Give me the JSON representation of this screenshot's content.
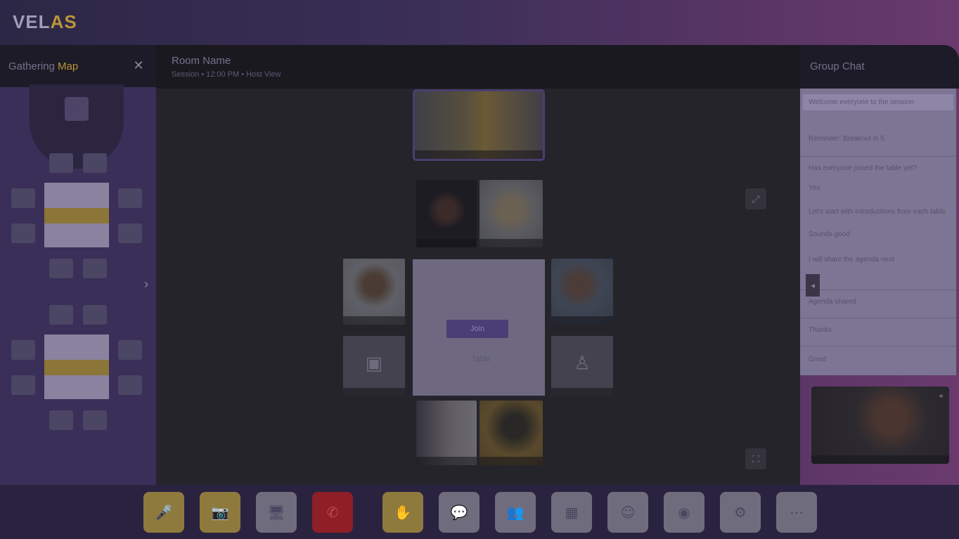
{
  "app": {
    "logo_main": "VEL",
    "logo_accent": "AS"
  },
  "left_panel": {
    "title_start": "Gathering ",
    "title_highlight": "Map",
    "close_icon": "close-icon"
  },
  "main": {
    "room_name": "Room Name",
    "room_meta": "Session • 12:00 PM • Host View"
  },
  "center_card": {
    "button_label": "Join",
    "caption": "Table"
  },
  "right_panel": {
    "title": "Group Chat",
    "messages": [
      "Welcome everyone to the session",
      "Reminder: Breakout in 5",
      "Has everyone joined the table yet?",
      "Yes",
      "Let's start with introductions from each table",
      "Sounds good",
      "I will share the agenda next",
      "Agenda shared",
      "Thanks",
      "Great"
    ]
  },
  "bottom_bar": {
    "controls": [
      {
        "name": "mic-button",
        "icon": "🎤",
        "style": "gold"
      },
      {
        "name": "camera-button",
        "icon": "📷",
        "style": "gold"
      },
      {
        "name": "screen-share-button",
        "icon": "🖥",
        "style": "grey"
      },
      {
        "name": "leave-button",
        "icon": "✆",
        "style": "red"
      },
      {
        "name": "hand-raise-button",
        "icon": "✋",
        "style": "gold"
      },
      {
        "name": "chat-button",
        "icon": "💬",
        "style": "grey"
      },
      {
        "name": "people-button",
        "icon": "👥",
        "style": "grey"
      },
      {
        "name": "grid-button",
        "icon": "▦",
        "style": "grey"
      },
      {
        "name": "reactions-button",
        "icon": "☺",
        "style": "grey"
      },
      {
        "name": "record-button",
        "icon": "◉",
        "style": "grey"
      },
      {
        "name": "settings-button",
        "icon": "⚙",
        "style": "grey"
      },
      {
        "name": "more-button",
        "icon": "⋯",
        "style": "grey"
      }
    ]
  },
  "colors": {
    "accent_gold": "#b8953a",
    "brand_purple": "#4b3e76",
    "danger_red": "#8e1f26"
  }
}
